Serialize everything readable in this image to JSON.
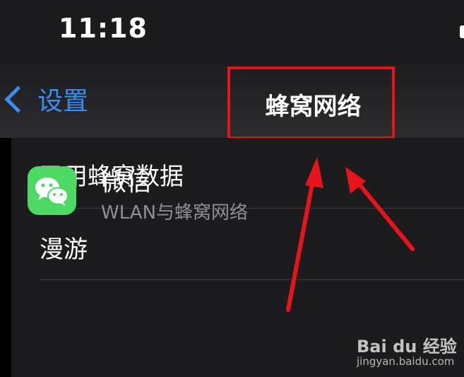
{
  "status_bar": {
    "time": "11:18"
  },
  "nav": {
    "back_label": "设置",
    "title": "蜂窝网络"
  },
  "list": {
    "rows": [
      {
        "label": "已用蜂窝数据"
      },
      {
        "label": "漫游"
      }
    ],
    "app": {
      "name": "微信",
      "subtitle": "WLAN与蜂窝网络"
    }
  },
  "watermark": {
    "brand": "Bai du 经验",
    "url": "jingyan.baidu.com"
  },
  "colors": {
    "accent_blue": "#3a8df5",
    "annotation_red": "#e8141c",
    "wechat_green": "#4cd964",
    "background": "#1c1c1e"
  }
}
